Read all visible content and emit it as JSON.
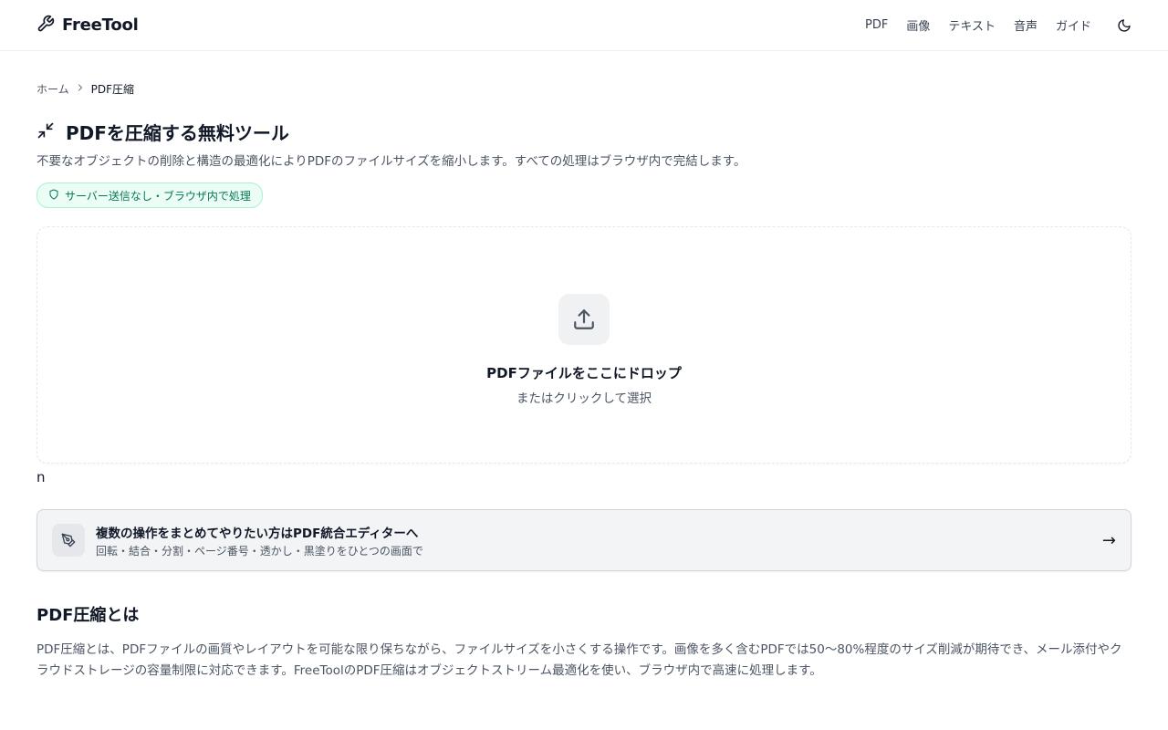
{
  "header": {
    "logo_text": "FreeTool",
    "nav": [
      "PDF",
      "画像",
      "テキスト",
      "音声",
      "ガイド"
    ]
  },
  "breadcrumb": {
    "home": "ホーム",
    "current": "PDF圧縮"
  },
  "page": {
    "title": "PDFを圧縮する無料ツール",
    "description": "不要なオブジェクトの削除と構造の最適化によりPDFのファイルサイズを縮小します。すべての処理はブラウザ内で完結します。",
    "badge": "サーバー送信なし・ブラウザ内で処理"
  },
  "dropzone": {
    "title": "PDFファイルをここにドロップ",
    "subtitle": "またはクリックして選択"
  },
  "stray_text": "n",
  "editor_card": {
    "title": "複数の操作をまとめてやりたい方はPDF統合エディターへ",
    "subtitle": "回転・結合・分割・ページ番号・透かし・黒塗りをひとつの画面で",
    "arrow": "→"
  },
  "about": {
    "heading": "PDF圧縮とは",
    "body": "PDF圧縮とは、PDFファイルの画質やレイアウトを可能な限り保ちながら、ファイルサイズを小さくする操作です。画像を多く含むPDFでは50〜80%程度のサイズ削減が期待でき、メール添付やクラウドストレージの容量制限に対応できます。FreeToolのPDF圧縮はオブジェクトストリーム最適化を使い、ブラウザ内で高速に処理します。"
  },
  "icons": {
    "logo": "wrench-icon",
    "theme": "moon-icon",
    "breadcrumb_sep": "chevron-right-icon",
    "title": "minimize-icon",
    "badge": "shield-icon",
    "upload": "upload-icon",
    "editor": "pen-tool-icon",
    "arrow": "arrow-right-icon"
  },
  "colors": {
    "badge_text": "#047857",
    "badge_bg": "#ecfdf5",
    "badge_border": "#a7f3d0"
  }
}
